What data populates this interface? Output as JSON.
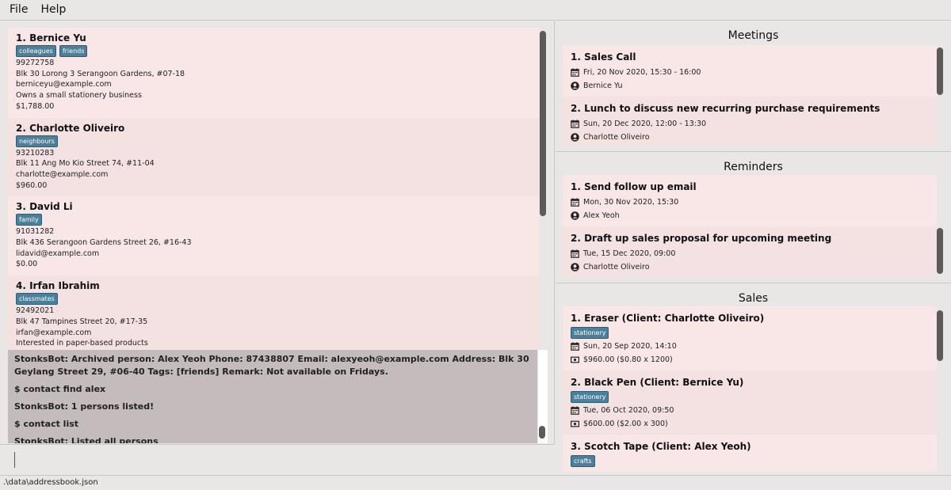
{
  "menu": {
    "file": "File",
    "help": "Help"
  },
  "persons": [
    {
      "index": "1.",
      "name": "Bernice Yu",
      "tags": [
        "colleagues",
        "friends"
      ],
      "phone": "99272758",
      "address": "Blk 30 Lorong 3 Serangoon Gardens, #07-18",
      "email": "berniceyu@example.com",
      "remark": "Owns a small stationery business",
      "total": "$1,788.00"
    },
    {
      "index": "2.",
      "name": "Charlotte Oliveiro",
      "tags": [
        "neighbours"
      ],
      "phone": "93210283",
      "address": "Blk 11 Ang Mo Kio Street 74, #11-04",
      "email": "charlotte@example.com",
      "remark": "",
      "total": "$960.00"
    },
    {
      "index": "3.",
      "name": "David Li",
      "tags": [
        "family"
      ],
      "phone": "91031282",
      "address": "Blk 436 Serangoon Gardens Street 26, #16-43",
      "email": "lidavid@example.com",
      "remark": "",
      "total": "$0.00"
    },
    {
      "index": "4.",
      "name": "Irfan Ibrahim",
      "tags": [
        "classmates"
      ],
      "phone": "92492021",
      "address": "Blk 47 Tampines Street 20, #17-35",
      "email": "irfan@example.com",
      "remark": "Interested in paper-based products",
      "total": ""
    }
  ],
  "result_lines": [
    "StonksBot: Archived person: Alex Yeoh Phone: 87438807 Email: alexyeoh@example.com Address: Blk 30 Geylang Street 29, #06-40 Tags: [friends] Remark: Not available on Fridays.",
    "$ contact find alex",
    "StonksBot: 1 persons listed!",
    "$ contact list",
    "StonksBot: Listed all persons"
  ],
  "command_input": "",
  "meetings": {
    "title": "Meetings",
    "items": [
      {
        "index": "1.",
        "title": "Sales Call",
        "datetime": "Fri, 20 Nov 2020, 15:30 - 16:00",
        "person": "Bernice Yu"
      },
      {
        "index": "2.",
        "title": "Lunch to discuss new recurring purchase requirements",
        "datetime": "Sun, 20 Dec 2020, 12:00 - 13:30",
        "person": "Charlotte Oliveiro"
      }
    ]
  },
  "reminders": {
    "title": "Reminders",
    "items": [
      {
        "index": "1.",
        "title": "Send follow up email",
        "datetime": "Mon, 30 Nov 2020, 15:30",
        "person": "Alex Yeoh"
      },
      {
        "index": "2.",
        "title": "Draft up sales proposal for upcoming meeting",
        "datetime": "Tue, 15 Dec 2020, 09:00",
        "person": "Charlotte Oliveiro"
      }
    ]
  },
  "sales": {
    "title": "Sales",
    "items": [
      {
        "index": "1.",
        "title": "Eraser (Client: Charlotte Oliveiro)",
        "tag": "stationery",
        "datetime": "Sun, 20 Sep 2020, 14:10",
        "amount": "$960.00 ($0.80 x 1200)"
      },
      {
        "index": "2.",
        "title": "Black Pen (Client: Bernice Yu)",
        "tag": "stationery",
        "datetime": "Tue, 06 Oct 2020, 09:50",
        "amount": "$600.00 ($2.00 x 300)"
      },
      {
        "index": "3.",
        "title": "Scotch Tape (Client: Alex Yeoh)",
        "tag": "crafts",
        "datetime": "",
        "amount": ""
      }
    ]
  },
  "status_bar": ".\\data\\addressbook.json",
  "colors": {
    "tag": "#4b7f9a",
    "card_odd": "#f9e6e6",
    "card_even": "#f4e1e2",
    "result_bg": "#c4bcbc"
  }
}
